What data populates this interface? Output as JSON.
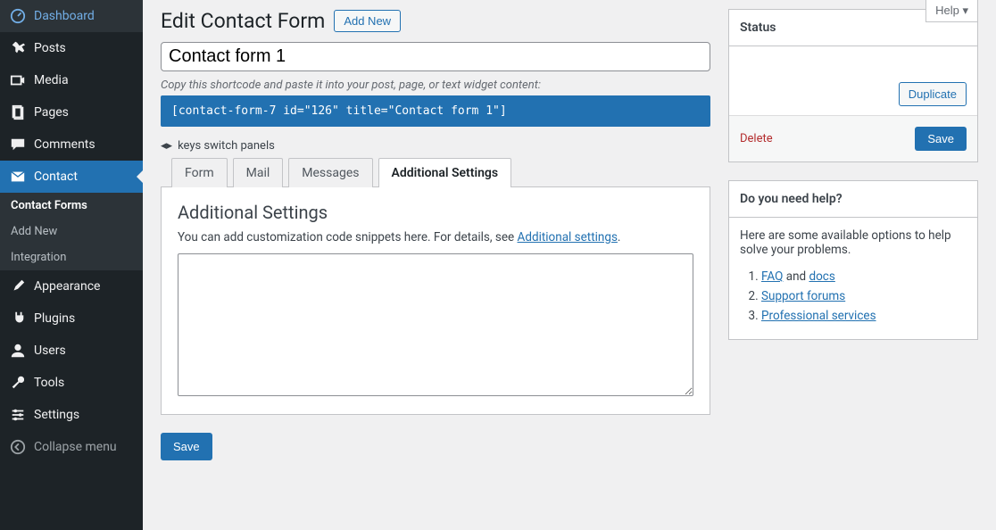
{
  "help_tab": "Help ▾",
  "sidebar": {
    "items": [
      {
        "label": "Dashboard"
      },
      {
        "label": "Posts"
      },
      {
        "label": "Media"
      },
      {
        "label": "Pages"
      },
      {
        "label": "Comments"
      },
      {
        "label": "Contact"
      },
      {
        "label": "Appearance"
      },
      {
        "label": "Plugins"
      },
      {
        "label": "Users"
      },
      {
        "label": "Tools"
      },
      {
        "label": "Settings"
      },
      {
        "label": "Collapse menu"
      }
    ],
    "submenu": [
      {
        "label": "Contact Forms"
      },
      {
        "label": "Add New"
      },
      {
        "label": "Integration"
      }
    ]
  },
  "heading": "Edit Contact Form",
  "add_new": "Add New",
  "form_title": "Contact form 1",
  "shortcode_hint": "Copy this shortcode and paste it into your post, page, or text widget content:",
  "shortcode": "[contact-form-7 id=\"126\" title=\"Contact form 1\"]",
  "keys_hint": "keys switch panels",
  "tabs": [
    {
      "label": "Form"
    },
    {
      "label": "Mail"
    },
    {
      "label": "Messages"
    },
    {
      "label": "Additional Settings"
    }
  ],
  "panel": {
    "title": "Additional Settings",
    "desc_before": "You can add customization code snippets here. For details, see ",
    "desc_link": "Additional settings",
    "desc_after": "."
  },
  "save": "Save",
  "status_box": {
    "title": "Status",
    "duplicate": "Duplicate",
    "delete": "Delete",
    "save": "Save"
  },
  "help_box": {
    "title": "Do you need help?",
    "intro": "Here are some available options to help solve your problems.",
    "items": [
      {
        "prefix": "",
        "link": "FAQ",
        "mid": " and ",
        "link2": "docs"
      },
      {
        "link": "Support forums"
      },
      {
        "link": "Professional services"
      }
    ]
  }
}
